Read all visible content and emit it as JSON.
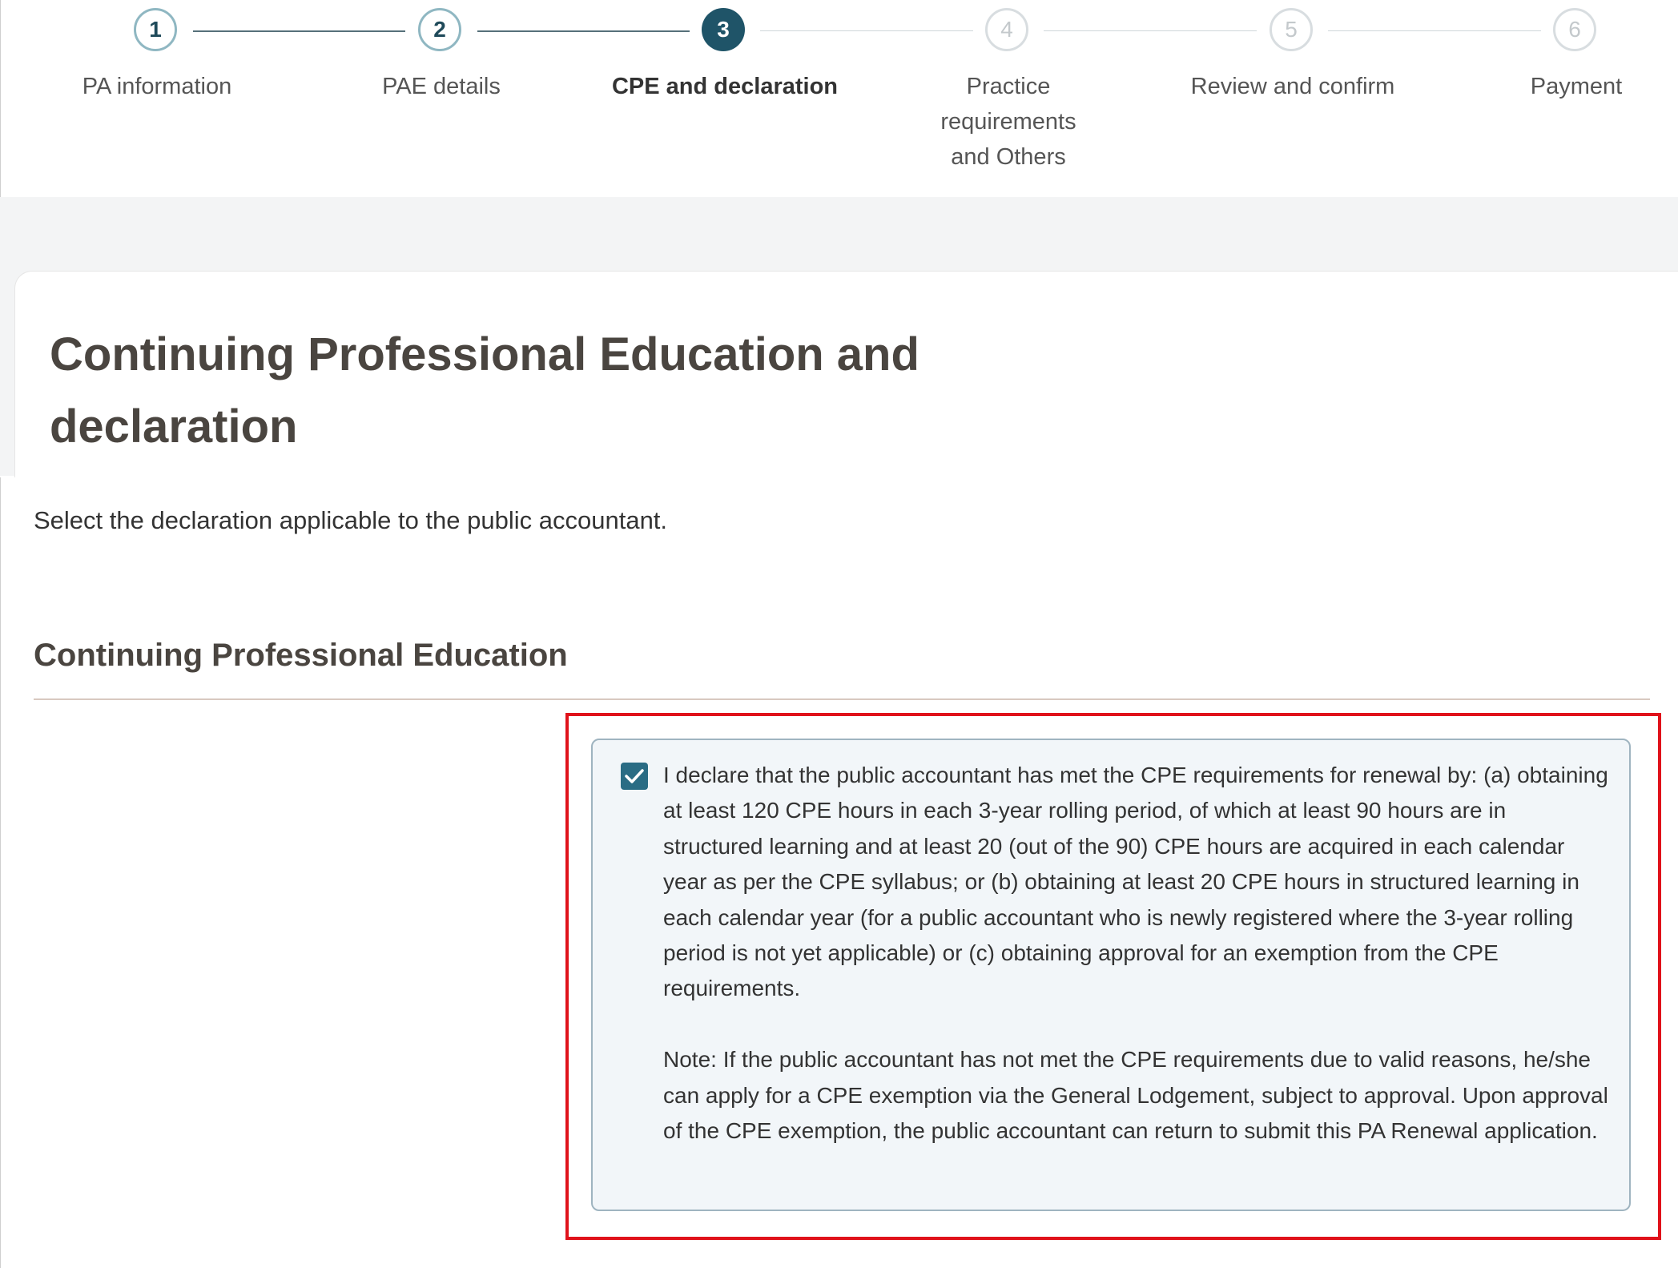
{
  "stepper": {
    "steps": [
      {
        "number": "1",
        "label": "PA information",
        "state": "done"
      },
      {
        "number": "2",
        "label": "PAE details",
        "state": "done"
      },
      {
        "number": "3",
        "label": "CPE and declaration",
        "state": "active"
      },
      {
        "number": "4",
        "label": "Practice requirements and Others",
        "state": "pending"
      },
      {
        "number": "5",
        "label": "Review and confirm",
        "state": "pending"
      },
      {
        "number": "6",
        "label": "Payment",
        "state": "pending"
      }
    ]
  },
  "page": {
    "title": "Continuing Professional Education and declaration",
    "instruction": "Select the declaration applicable to the public accountant."
  },
  "cpe_section": {
    "title": "Continuing Professional Education",
    "declaration": {
      "checked": true,
      "text": "I declare that the public accountant has met the CPE requirements for renewal by: (a) obtaining at least 120 CPE hours in each 3-year rolling period, of which at least 90 hours are in structured learning and at least 20 (out of the 90) CPE hours are acquired in each calendar year as per the CPE syllabus; or (b) obtaining at least 20 CPE hours in structured learning in each calendar year (for a public accountant who is newly registered where the 3-year rolling period is not yet applicable) or (c) obtaining approval for an exemption from the CPE requirements.",
      "note": "Note: If the public accountant has not met the CPE requirements due to valid reasons, he/she can apply for a CPE exemption via the General Lodgement, subject to approval. Upon approval of the CPE exemption, the public accountant can return to submit this PA Renewal application."
    }
  },
  "colors": {
    "active_step": "#1f5468",
    "checkbox": "#2a6c84",
    "highlight": "#e0121b",
    "title": "#4a4540"
  }
}
